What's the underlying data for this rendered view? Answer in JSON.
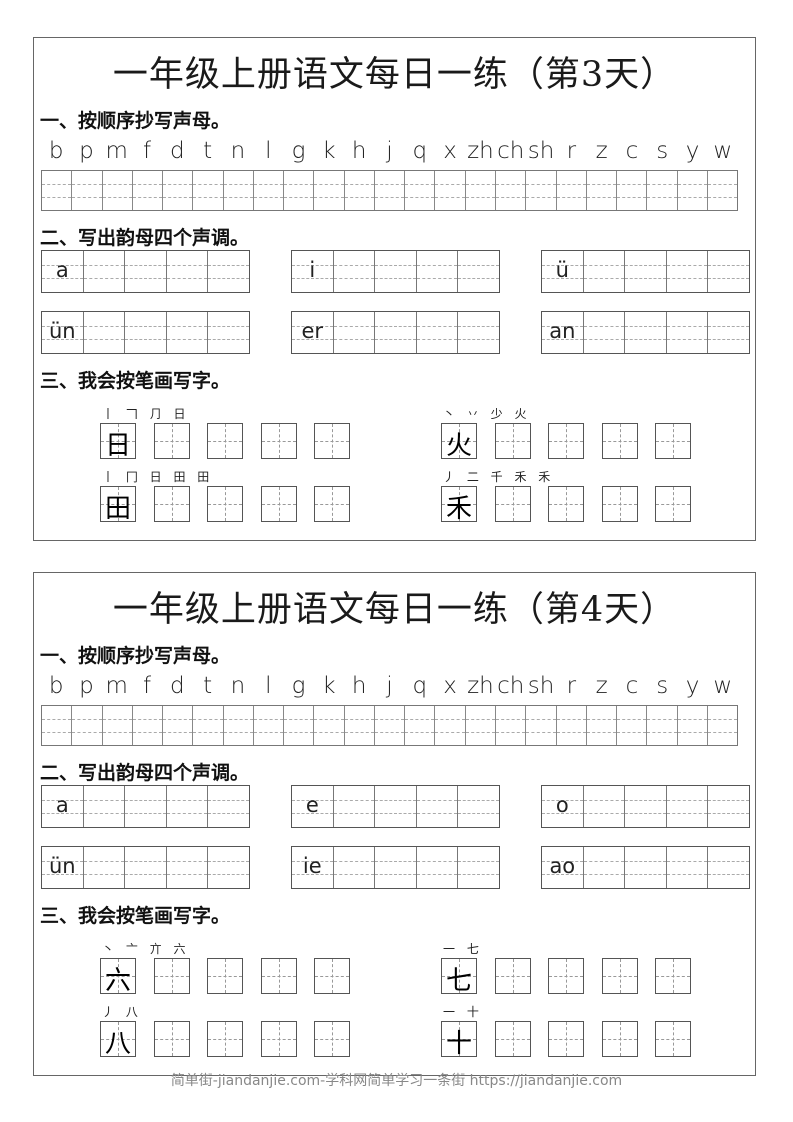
{
  "sheets": [
    {
      "title": "一年级上册语文每日一练（第3天）",
      "section1": {
        "heading": "一、按顺序抄写声母。"
      },
      "section2": {
        "heading": "二、写出韵母四个声调。",
        "rows": [
          [
            "a",
            "i",
            "ü"
          ],
          [
            "ün",
            "er",
            "an"
          ]
        ]
      },
      "section3": {
        "heading": "三、我会按笔画写字。",
        "rows": [
          [
            {
              "char": "日",
              "strokes": "丨 𠃍 ⺆ 日"
            },
            {
              "char": "火",
              "strokes": "丶 丷 少 火"
            }
          ],
          [
            {
              "char": "田",
              "strokes": "丨 冂 日 田 田"
            },
            {
              "char": "禾",
              "strokes": "丿 二 千 禾 禾"
            }
          ]
        ]
      }
    },
    {
      "title": "一年级上册语文每日一练（第4天）",
      "section1": {
        "heading": "一、按顺序抄写声母。"
      },
      "section2": {
        "heading": "二、写出韵母四个声调。",
        "rows": [
          [
            "a",
            "e",
            "o"
          ],
          [
            "ün",
            "ie",
            "ao"
          ]
        ]
      },
      "section3": {
        "heading": "三、我会按笔画写字。",
        "rows": [
          [
            {
              "char": "六",
              "strokes": "丶 亠 亣 六"
            },
            {
              "char": "七",
              "strokes": "一 七"
            }
          ],
          [
            {
              "char": "八",
              "strokes": "丿 八"
            },
            {
              "char": "十",
              "strokes": "一 十"
            }
          ]
        ]
      }
    }
  ],
  "initials": [
    "b",
    "p",
    "m",
    "f",
    "d",
    "t",
    "n",
    "l",
    "g",
    "k",
    "h",
    "j",
    "q",
    "x",
    "zh",
    "ch",
    "sh",
    "r",
    "z",
    "c",
    "s",
    "y",
    "w"
  ],
  "footer": "简单街-jiandanjie.com-学科网简单学习一条街 https://jiandanjie.com"
}
